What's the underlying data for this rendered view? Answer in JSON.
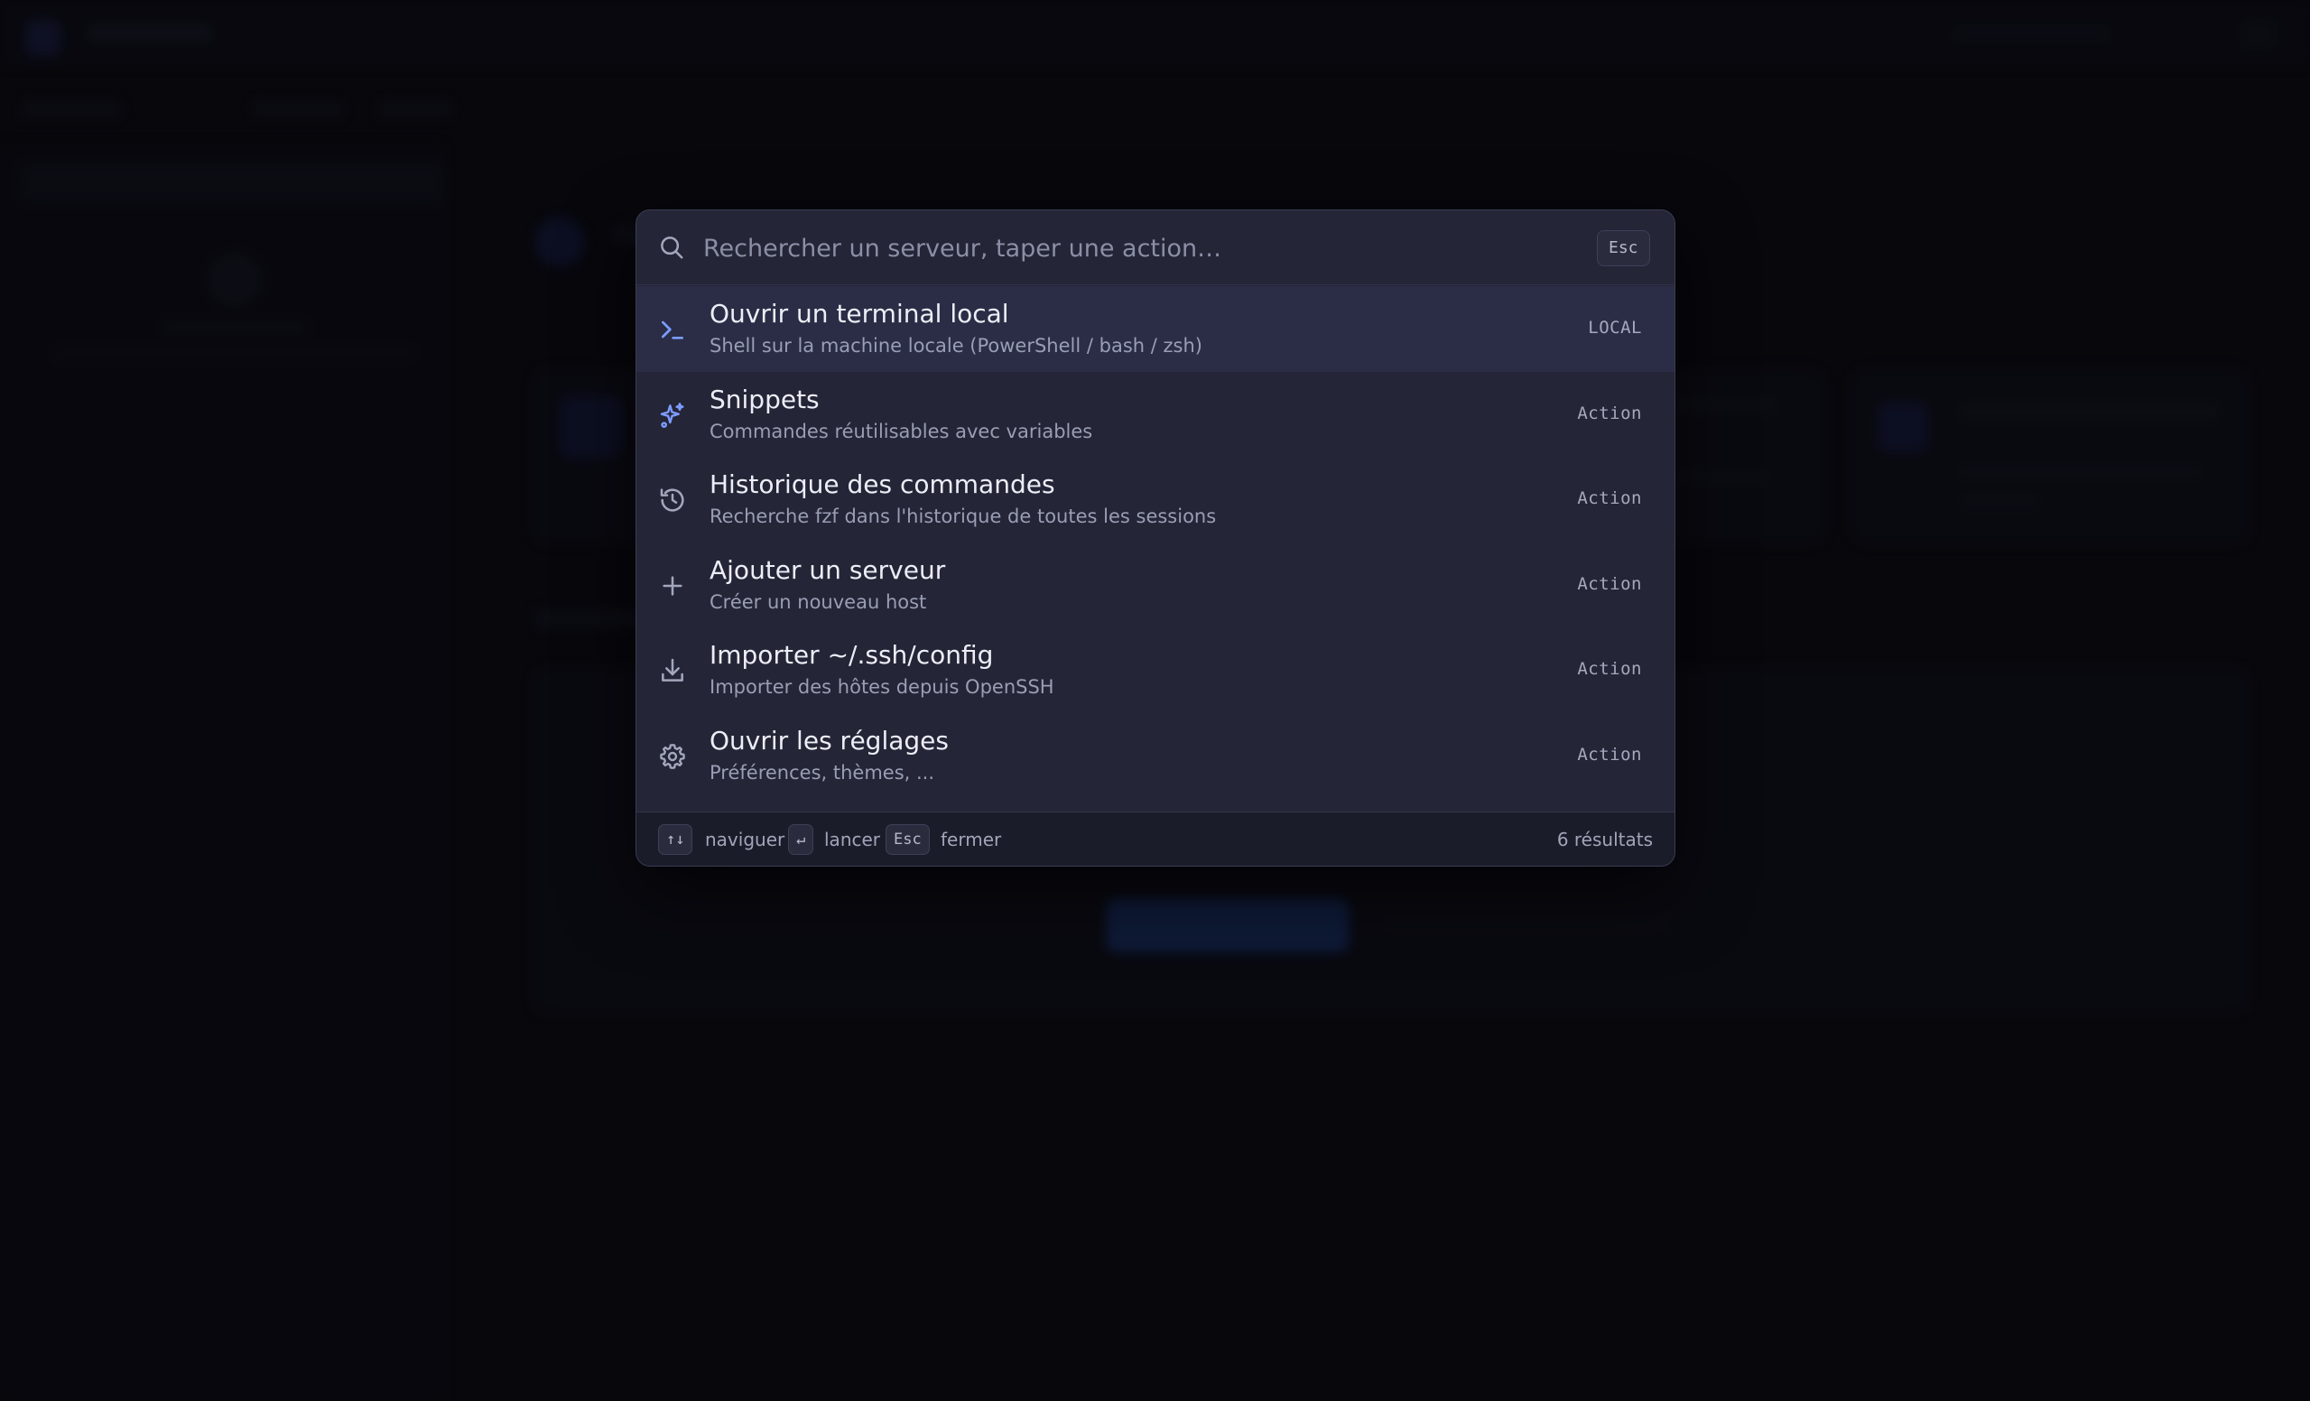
{
  "search": {
    "placeholder": "Rechercher un serveur, taper une action…",
    "value": "",
    "close_key": "Esc"
  },
  "results": [
    {
      "title": "Ouvrir un terminal local",
      "subtitle": "Shell sur la machine locale (PowerShell / bash / zsh)",
      "tag": "LOCAL",
      "icon": "terminal-icon",
      "selected": true
    },
    {
      "title": "Snippets",
      "subtitle": "Commandes réutilisables avec variables",
      "tag": "Action",
      "icon": "sparkles-icon",
      "selected": false
    },
    {
      "title": "Historique des commandes",
      "subtitle": "Recherche fzf dans l'historique de toutes les sessions",
      "tag": "Action",
      "icon": "history-icon",
      "selected": false
    },
    {
      "title": "Ajouter un serveur",
      "subtitle": "Créer un nouveau host",
      "tag": "Action",
      "icon": "plus-icon",
      "selected": false
    },
    {
      "title": "Importer ~/.ssh/config",
      "subtitle": "Importer des hôtes depuis OpenSSH",
      "tag": "Action",
      "icon": "download-icon",
      "selected": false
    },
    {
      "title": "Ouvrir les réglages",
      "subtitle": "Préférences, thèmes, ...",
      "tag": "Action",
      "icon": "gear-icon",
      "selected": false
    }
  ],
  "footer": {
    "navigate_key": "↑↓",
    "navigate_label": "naviguer",
    "launch_key": "↵",
    "launch_label": "lancer",
    "close_key": "Esc",
    "close_label": "fermer",
    "count_label": "6 résultats"
  },
  "colors": {
    "accent": "#7c9cff",
    "panel": "#242536",
    "selected_row": "#2a2d45"
  }
}
